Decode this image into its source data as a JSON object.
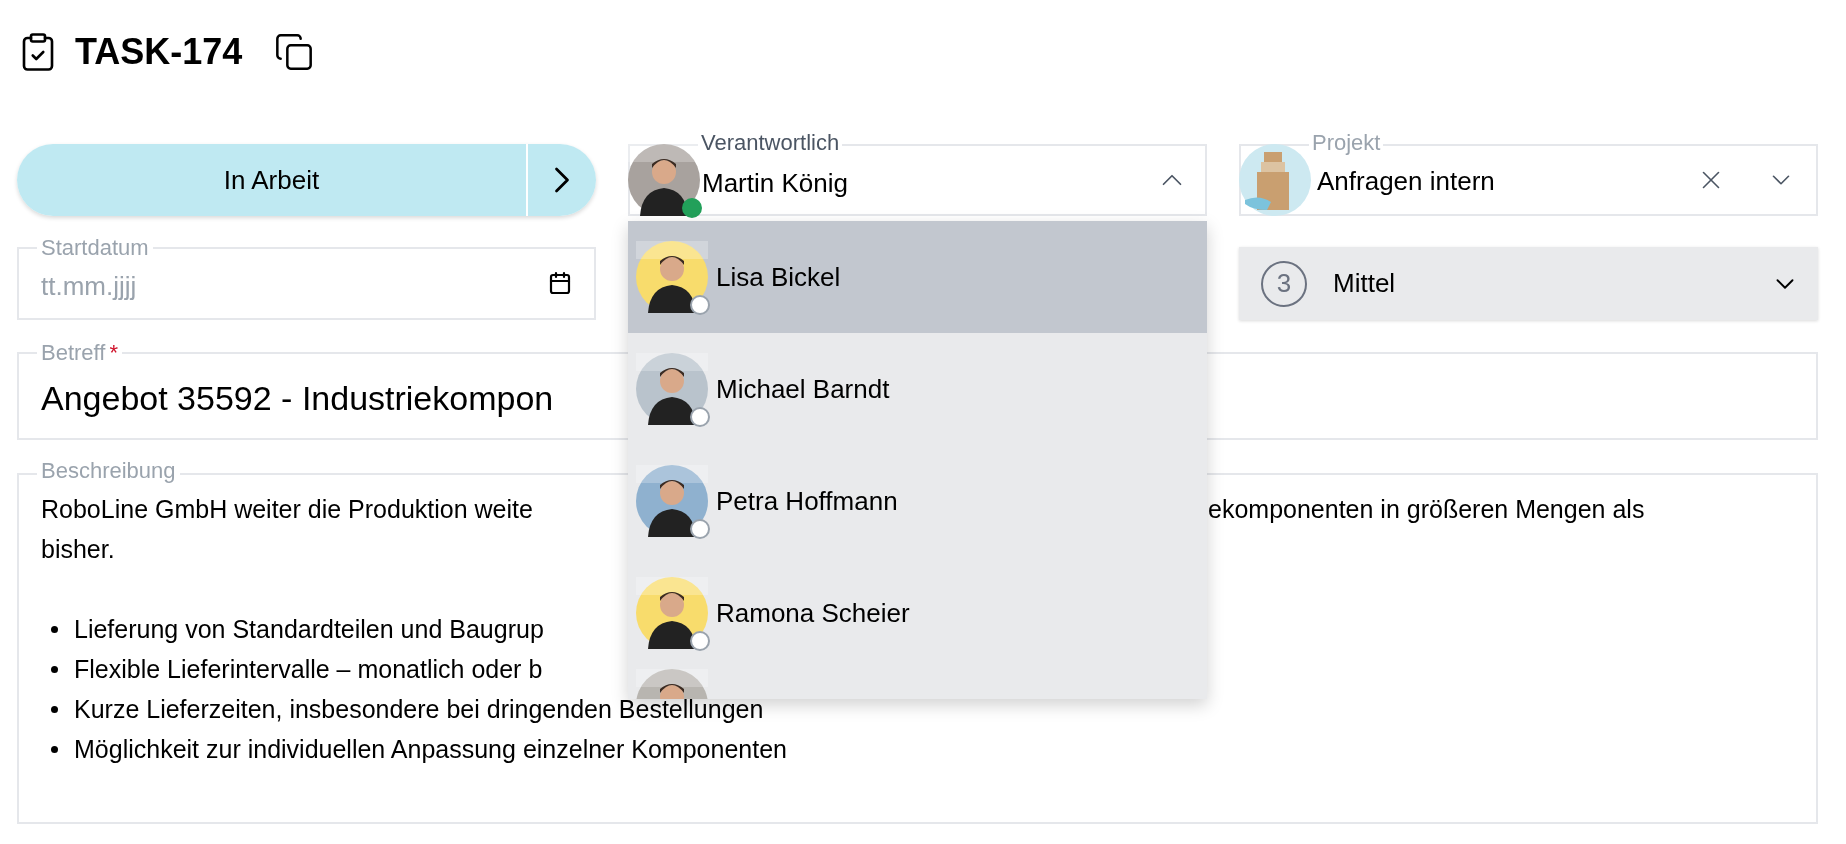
{
  "header": {
    "title": "TASK-174"
  },
  "status": {
    "label": "In Arbeit"
  },
  "assignee": {
    "label": "Verantwortlich",
    "value": "Martin König",
    "online": true,
    "expanded": true,
    "options": [
      {
        "name": "Lisa Bickel",
        "selected": true,
        "online": false,
        "color": "#f8dc6c"
      },
      {
        "name": "Michael Barndt",
        "selected": false,
        "online": false,
        "color": "#b9c3cc"
      },
      {
        "name": "Petra Hoffmann",
        "selected": false,
        "online": false,
        "color": "#8fb1cf"
      },
      {
        "name": "Ramona Scheier",
        "selected": false,
        "online": false,
        "color": "#f8dc6c"
      }
    ]
  },
  "project": {
    "label": "Projekt",
    "value": "Anfragen intern"
  },
  "start_date": {
    "label": "Startdatum",
    "placeholder": "tt.mm.jjjj"
  },
  "priority": {
    "number": "3",
    "label": "Mittel"
  },
  "subject": {
    "label": "Betreff",
    "required": "*",
    "value": "Angebot 35592 - Industriekompon"
  },
  "description": {
    "label": "Beschreibung",
    "line_1_left": "RoboLine GmbH weiter die Produktion weite",
    "line_1_right": "ekomponenten in größeren Mengen als",
    "line_2": "bisher.",
    "bullets": [
      "Lieferung von Standardteilen und Baugrup",
      "Flexible Lieferintervalle – monatlich oder b",
      "Kurze Lieferzeiten, insbesondere bei dringenden Bestellungen",
      "Möglichkeit zur individuellen Anpassung einzelner Komponenten"
    ]
  }
}
